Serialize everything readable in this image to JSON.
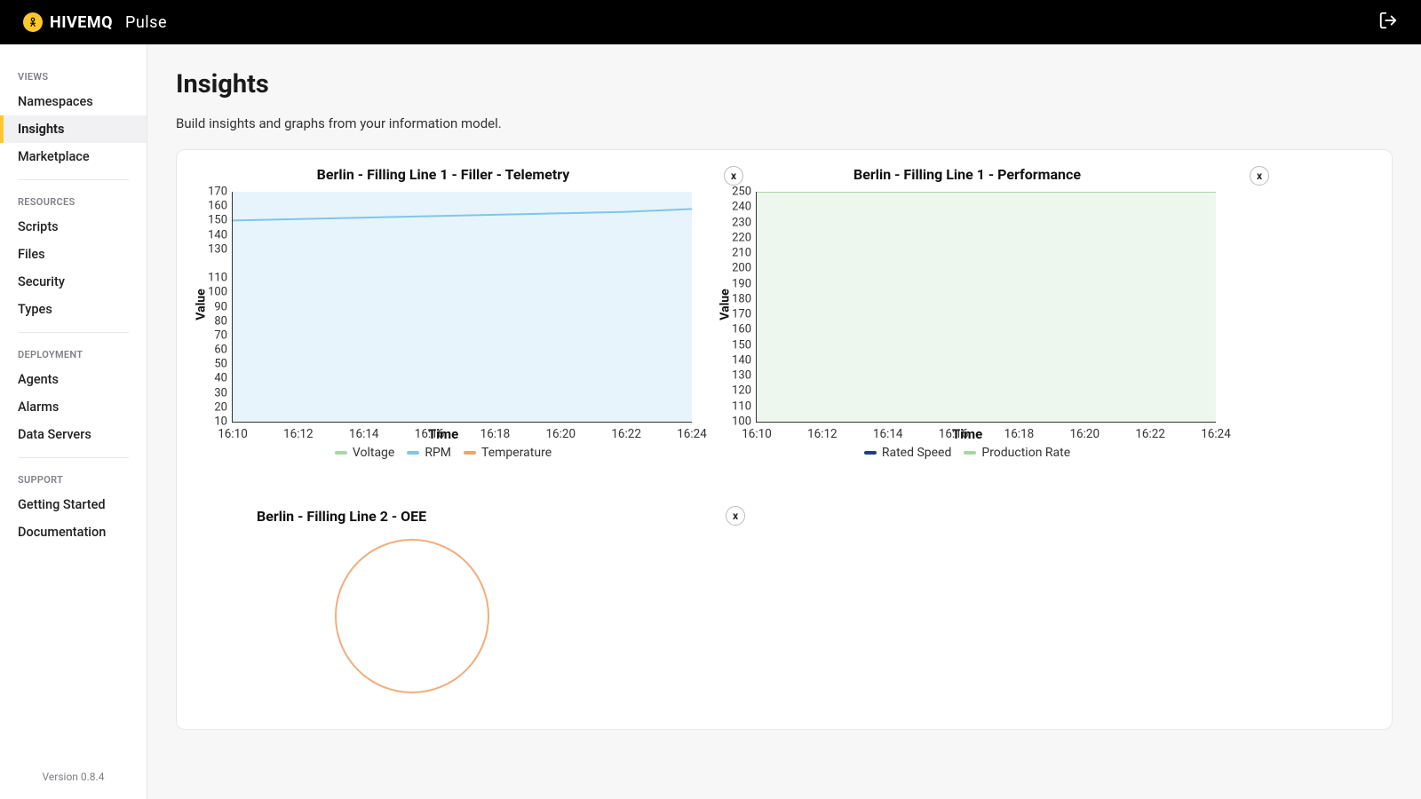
{
  "brand": {
    "main": "HIVEMQ",
    "sub": "Pulse"
  },
  "sidebar": {
    "groups": [
      {
        "label": "VIEWS",
        "items": [
          "Namespaces",
          "Insights",
          "Marketplace"
        ],
        "active": "Insights"
      },
      {
        "label": "RESOURCES",
        "items": [
          "Scripts",
          "Files",
          "Security",
          "Types"
        ]
      },
      {
        "label": "DEPLOYMENT",
        "items": [
          "Agents",
          "Alarms",
          "Data Servers"
        ]
      },
      {
        "label": "SUPPORT",
        "items": [
          "Getting Started",
          "Documentation"
        ]
      }
    ],
    "version": "Version 0.8.4"
  },
  "page": {
    "title": "Insights",
    "description": "Build insights and graphs from your information model."
  },
  "chart_data": [
    {
      "id": "telemetry",
      "type": "line",
      "title": "Berlin - Filling Line 1 - Filler - Telemetry",
      "xlabel": "Time",
      "ylabel": "Value",
      "ylim": [
        10,
        170
      ],
      "yticks": [
        10,
        20,
        30,
        40,
        50,
        60,
        70,
        80,
        90,
        100,
        110,
        130,
        140,
        150,
        160,
        170
      ],
      "x": [
        "16:10",
        "16:12",
        "16:14",
        "16:16",
        "16:18",
        "16:20",
        "16:22",
        "16:24"
      ],
      "series": [
        {
          "name": "Voltage",
          "color": "#a9d7a3",
          "values": null
        },
        {
          "name": "RPM",
          "color": "#7fc6e8",
          "values": [
            150,
            151,
            152,
            153,
            154,
            155,
            156,
            158
          ]
        },
        {
          "name": "Temperature",
          "color": "#e8a76b",
          "values": null
        }
      ],
      "area_fill": "#e8f4fb"
    },
    {
      "id": "performance",
      "type": "area",
      "title": "Berlin - Filling Line 1 - Performance",
      "xlabel": "Time",
      "ylabel": "Value",
      "ylim": [
        100,
        250
      ],
      "yticks": [
        100,
        110,
        120,
        130,
        140,
        150,
        160,
        170,
        180,
        190,
        200,
        210,
        220,
        230,
        240,
        250
      ],
      "x": [
        "16:10",
        "16:12",
        "16:14",
        "16:16",
        "16:18",
        "16:20",
        "16:22",
        "16:24"
      ],
      "series": [
        {
          "name": "Rated Speed",
          "color": "#1f3e8a",
          "values": [
            250,
            250,
            250,
            250,
            250,
            250,
            250,
            250
          ]
        },
        {
          "name": "Production Rate",
          "color": "#a9d7a3",
          "values": [
            250,
            250,
            250,
            250,
            250,
            250,
            250,
            250
          ]
        }
      ],
      "area_fill": "#eef7ed"
    },
    {
      "id": "oee",
      "type": "pie",
      "title": "Berlin - Filling Line 2 - OEE",
      "series": [
        {
          "name": "OEE",
          "color": "#f3ad7a",
          "value": 100
        }
      ]
    }
  ],
  "close_label": "x"
}
